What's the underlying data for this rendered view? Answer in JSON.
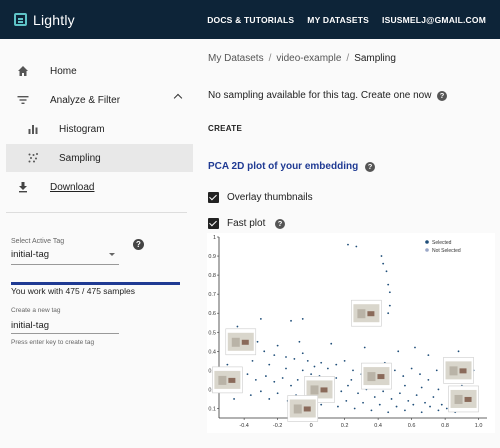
{
  "topbar": {
    "brand": "Lightly",
    "links": [
      "DOCS & TUTORIALS",
      "MY DATASETS",
      "ISUSMELJ@GMAIL.COM"
    ]
  },
  "sidebar": {
    "items": [
      {
        "label": "Home",
        "icon": "home-icon"
      },
      {
        "label": "Analyze & Filter",
        "icon": "filter-icon"
      },
      {
        "label": "Histogram",
        "icon": "bar-chart-icon"
      },
      {
        "label": "Sampling",
        "icon": "scatter-icon"
      },
      {
        "label": "Download",
        "icon": "download-icon"
      }
    ],
    "tag_select_label": "Select Active Tag",
    "tag_select_value": "initial-tag",
    "samples_text": "You work with 475 / 475 samples",
    "samples_fraction": 1.0,
    "new_tag_label": "Create a new tag",
    "new_tag_value": "initial-tag",
    "new_tag_hint": "Press enter key to create tag"
  },
  "main": {
    "breadcrumb": [
      "My Datasets",
      "video-example",
      "Sampling"
    ],
    "no_sampling_text": "No sampling available for this tag. Create one now",
    "create_label": "CREATE",
    "pca_title": "PCA 2D plot of your embedding",
    "overlay_label": "Overlay thumbnails",
    "fastplot_label": "Fast plot",
    "overlay_checked": true,
    "fastplot_checked": true
  },
  "colors": {
    "topbar": "#0d2438",
    "accent": "#1f3a93",
    "selected_point": "#1f4e79",
    "not_selected_point": "#9aa7c7"
  },
  "chart_data": {
    "type": "scatter",
    "x_ticks": [
      "-0.4",
      "-0.2",
      "0",
      "0.2",
      "0.4",
      "0.6",
      "0.8",
      "1.0"
    ],
    "y_ticks": [
      "1",
      "0.9",
      "0.8",
      "0.7",
      "0.6",
      "0.5",
      "0.4",
      "0.3",
      "0.2",
      "0.1"
    ],
    "xlim": [
      -0.55,
      1.05
    ],
    "ylim": [
      0.05,
      1.0
    ],
    "legend": [
      "Selected",
      "Not Selected"
    ],
    "legend_position": "top-right",
    "series": [
      {
        "name": "Selected",
        "points": [
          [
            0.22,
            0.96
          ],
          [
            0.27,
            0.95
          ],
          [
            0.42,
            0.9
          ],
          [
            0.43,
            0.86
          ],
          [
            0.45,
            0.82
          ],
          [
            0.46,
            0.75
          ],
          [
            0.47,
            0.71
          ],
          [
            0.47,
            0.64
          ],
          [
            0.46,
            0.6
          ],
          [
            0.4,
            0.56
          ],
          [
            0.35,
            0.55
          ],
          [
            -0.05,
            0.57
          ],
          [
            -0.12,
            0.56
          ],
          [
            -0.3,
            0.57
          ],
          [
            -0.44,
            0.53
          ],
          [
            -0.4,
            0.47
          ],
          [
            -0.32,
            0.45
          ],
          [
            -0.28,
            0.4
          ],
          [
            -0.22,
            0.38
          ],
          [
            -0.15,
            0.37
          ],
          [
            -0.1,
            0.36
          ],
          [
            -0.05,
            0.39
          ],
          [
            -0.02,
            0.35
          ],
          [
            0.02,
            0.32
          ],
          [
            0.06,
            0.34
          ],
          [
            0.1,
            0.31
          ],
          [
            0.15,
            0.33
          ],
          [
            0.2,
            0.35
          ],
          [
            0.25,
            0.3
          ],
          [
            0.3,
            0.28
          ],
          [
            0.35,
            0.32
          ],
          [
            0.4,
            0.3
          ],
          [
            0.44,
            0.34
          ],
          [
            0.5,
            0.3
          ],
          [
            0.55,
            0.27
          ],
          [
            0.6,
            0.31
          ],
          [
            0.65,
            0.28
          ],
          [
            0.7,
            0.25
          ],
          [
            0.75,
            0.3
          ],
          [
            0.8,
            0.33
          ],
          [
            0.85,
            0.27
          ],
          [
            0.9,
            0.22
          ],
          [
            0.95,
            0.24
          ],
          [
            -0.45,
            0.3
          ],
          [
            -0.38,
            0.28
          ],
          [
            -0.33,
            0.25
          ],
          [
            -0.27,
            0.27
          ],
          [
            -0.22,
            0.24
          ],
          [
            -0.17,
            0.26
          ],
          [
            -0.12,
            0.22
          ],
          [
            -0.08,
            0.25
          ],
          [
            -0.03,
            0.21
          ],
          [
            0.03,
            0.24
          ],
          [
            0.08,
            0.2
          ],
          [
            0.12,
            0.23
          ],
          [
            0.18,
            0.19
          ],
          [
            0.22,
            0.22
          ],
          [
            0.28,
            0.18
          ],
          [
            0.33,
            0.2
          ],
          [
            0.38,
            0.16
          ],
          [
            0.43,
            0.19
          ],
          [
            0.48,
            0.15
          ],
          [
            0.53,
            0.18
          ],
          [
            0.58,
            0.14
          ],
          [
            0.63,
            0.17
          ],
          [
            0.68,
            0.13
          ],
          [
            0.73,
            0.16
          ],
          [
            0.78,
            0.12
          ],
          [
            0.83,
            0.15
          ],
          [
            0.88,
            0.11
          ],
          [
            -0.42,
            0.2
          ],
          [
            -0.36,
            0.17
          ],
          [
            -0.3,
            0.19
          ],
          [
            -0.25,
            0.15
          ],
          [
            -0.2,
            0.18
          ],
          [
            -0.14,
            0.14
          ],
          [
            -0.09,
            0.17
          ],
          [
            -0.04,
            0.13
          ],
          [
            0.01,
            0.16
          ],
          [
            0.06,
            0.12
          ],
          [
            0.11,
            0.15
          ],
          [
            0.16,
            0.11
          ],
          [
            0.21,
            0.14
          ],
          [
            0.26,
            0.1
          ],
          [
            0.31,
            0.13
          ],
          [
            0.36,
            0.09
          ],
          [
            0.41,
            0.12
          ],
          [
            0.46,
            0.08
          ],
          [
            0.51,
            0.11
          ],
          [
            0.56,
            0.09
          ],
          [
            0.61,
            0.12
          ],
          [
            0.66,
            0.08
          ],
          [
            0.71,
            0.11
          ],
          [
            0.76,
            0.09
          ],
          [
            0.81,
            0.1
          ],
          [
            0.86,
            0.08
          ],
          [
            0.91,
            0.1
          ],
          [
            -0.5,
            0.33
          ],
          [
            -0.48,
            0.25
          ],
          [
            -0.46,
            0.15
          ],
          [
            0.97,
            0.3
          ],
          [
            0.99,
            0.18
          ],
          [
            0.93,
            0.36
          ],
          [
            0.88,
            0.4
          ],
          [
            0.7,
            0.38
          ],
          [
            0.62,
            0.42
          ],
          [
            0.52,
            0.4
          ],
          [
            0.32,
            0.42
          ],
          [
            0.12,
            0.44
          ],
          [
            -0.07,
            0.45
          ],
          [
            -0.2,
            0.43
          ],
          [
            0.0,
            0.28
          ],
          [
            0.05,
            0.27
          ],
          [
            0.15,
            0.26
          ],
          [
            0.24,
            0.25
          ],
          [
            0.34,
            0.24
          ],
          [
            0.45,
            0.23
          ],
          [
            0.56,
            0.22
          ],
          [
            0.66,
            0.21
          ],
          [
            0.76,
            0.2
          ],
          [
            0.86,
            0.19
          ],
          [
            -0.35,
            0.35
          ],
          [
            -0.25,
            0.33
          ],
          [
            -0.15,
            0.31
          ],
          [
            -0.05,
            0.3
          ]
        ]
      },
      {
        "name": "Not Selected",
        "points": []
      }
    ]
  }
}
